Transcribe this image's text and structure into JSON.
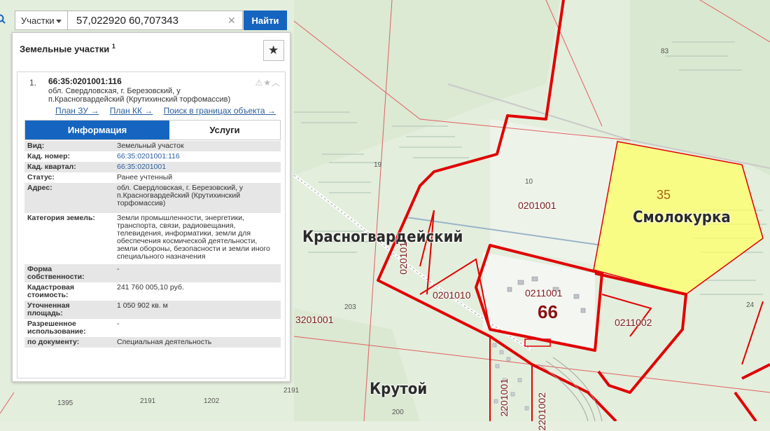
{
  "search": {
    "type_label": "Участки",
    "query": "57,022920 60,707343",
    "find_label": "Найти"
  },
  "panel": {
    "title": "Земельные участки",
    "count": "1"
  },
  "result": {
    "index": "1.",
    "cad_number": "66:35:0201001:116",
    "address": "обл. Свердловская, г. Березовский, у п.Красногвардейский (Крутихинский торфомассив)",
    "links": [
      "План ЗУ →",
      "План КК →",
      "Поиск в границах объекта →"
    ],
    "tabs": [
      "Информация",
      "Услуги"
    ],
    "props": [
      {
        "k": "Вид:",
        "v": "Земельный участок"
      },
      {
        "k": "Кад. номер:",
        "v": "66:35:0201001:116"
      },
      {
        "k": "Кад. квартал:",
        "v": "66:35:0201001"
      },
      {
        "k": "Статус:",
        "v": "Ранее учтенный"
      },
      {
        "k": "Адрес:",
        "v": "обл. Свердловская, г. Березовский, у п.Красногвардейский (Крутихинский торфомассив)"
      },
      {
        "k": "Категория земель:",
        "v": "Земли промышленности, энергетики, транспорта, связи, радиовещания, телевидения, информатики, земли для обеспечения космической деятельности, земли обороны, безопасности и земли иного специального назначения"
      },
      {
        "k": "Форма собственности:",
        "v": "-"
      },
      {
        "k": "Кадастровая стоимость:",
        "v": "241 760 005,10 руб."
      },
      {
        "k": "Уточненная площадь:",
        "v": "1 050 902 кв. м"
      },
      {
        "k": "Разрешенное использование:",
        "v": "-"
      },
      {
        "k": "по документу:",
        "v": "Специальная деятельность"
      }
    ]
  },
  "map": {
    "places": [
      "Красногвардейский",
      "Смолокурка",
      "Крутой"
    ],
    "quarters": [
      "0201001",
      "0201010",
      "0211001",
      "0211002",
      "3201001",
      "020101",
      "2201001",
      "2201002"
    ],
    "region_number": "66",
    "parcel_number": "35",
    "small_numbers": [
      "83",
      "19",
      "10",
      "203",
      "24",
      "2191",
      "1202",
      "2191",
      "1395",
      "200"
    ],
    "colors": {
      "boundary": "#e00000",
      "highlight": "#ffff66",
      "button": "#1565c0"
    }
  }
}
